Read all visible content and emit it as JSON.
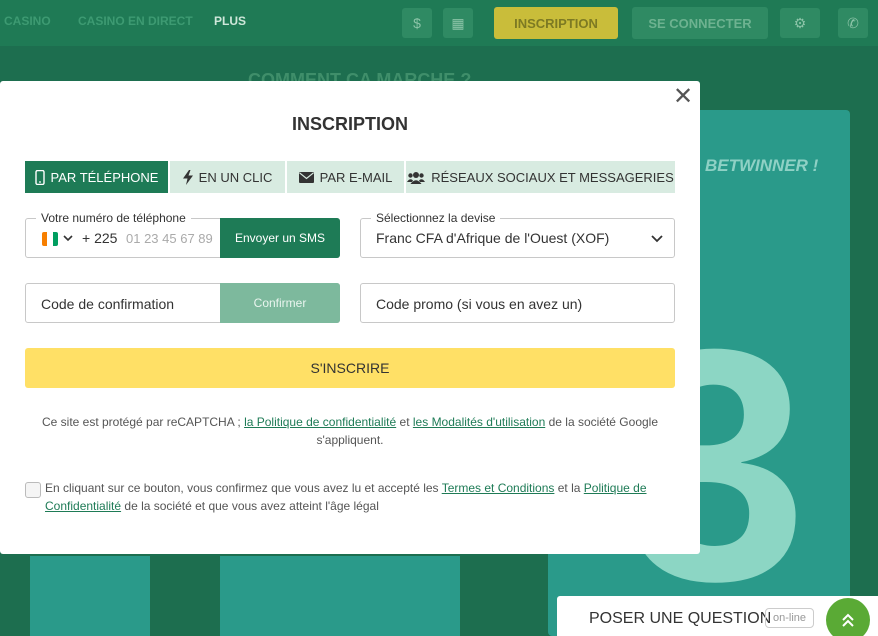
{
  "background": {
    "nav": {
      "casino": "CASINO",
      "live_casino": "CASINO EN DIRECT",
      "more": "PLUS"
    },
    "header": {
      "register_label": "INSCRIPTION",
      "login_label": "SE CONNECTER"
    },
    "heading": "COMMENT ÇA MARCHE ?",
    "panel_title": "BETWINNER !",
    "big_number": "3"
  },
  "modal": {
    "title": "INSCRIPTION",
    "tabs": [
      {
        "label": "PAR TÉLÉPHONE",
        "icon": "phone-icon",
        "active": true
      },
      {
        "label": "EN UN CLIC",
        "icon": "lightning-icon",
        "active": false
      },
      {
        "label": "PAR E-MAIL",
        "icon": "envelope-icon",
        "active": false
      },
      {
        "label": "RÉSEAUX SOCIAUX ET MESSAGERIES",
        "icon": "users-icon",
        "active": false
      }
    ],
    "phone": {
      "legend": "Votre numéro de téléphone",
      "prefix": "+ 225",
      "placeholder": "01 23 45 67 89",
      "sms_label": "Envoyer un SMS"
    },
    "currency": {
      "legend": "Sélectionnez la devise",
      "value": "Franc CFA d'Afrique de l'Ouest (XOF)"
    },
    "confirmation": {
      "placeholder": "Code de confirmation",
      "confirm_label": "Confirmer"
    },
    "promo": {
      "placeholder": "Code promo (si vous en avez un)"
    },
    "register_label": "S'INSCRIRE",
    "recaptcha": {
      "prefix": "Ce site est protégé par reCAPTCHA ;",
      "privacy_link": "la Politique de confidentialité",
      "and": "et",
      "terms_link": "les Modalités d'utilisation",
      "suffix": "de la société Google s'appliquent."
    },
    "terms": {
      "prefix": "En cliquant sur ce bouton, vous confirmez que vous avez lu et accepté les",
      "terms_link": "Termes et Conditions",
      "and": "et la",
      "privacy_link": "Politique de Confidentialité",
      "suffix": "de la société et que vous avez atteint l'âge légal"
    }
  },
  "chat": {
    "label": "POSER UNE QUESTION",
    "status": "on-line"
  },
  "colors": {
    "primary_green": "#1e7b56",
    "accent_yellow": "#ffe066",
    "tab_bg": "#d8ebe1"
  }
}
